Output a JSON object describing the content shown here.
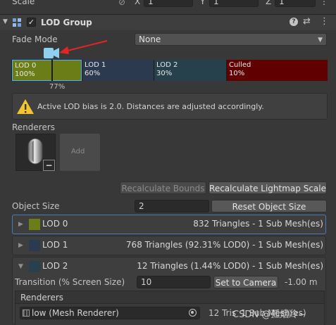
{
  "scale": {
    "label": "Scale",
    "x_label": "X",
    "x_value": "1",
    "y_label": "Y",
    "y_value": "1",
    "z_label": "Z",
    "z_value": "1"
  },
  "component": {
    "title": "LOD Group",
    "enabled": true
  },
  "fade_mode": {
    "label": "Fade Mode",
    "value": "None"
  },
  "lod_bar": {
    "marker_label": "77%",
    "segments": [
      {
        "name": "LOD 0",
        "percent": "100%",
        "color": "#6b7d17"
      },
      {
        "name": "LOD 1",
        "percent": "60%",
        "color": "#2c3a50"
      },
      {
        "name": "LOD 2",
        "percent": "30%",
        "color": "#27414c"
      },
      {
        "name": "Culled",
        "percent": "10%",
        "color": "#610000"
      }
    ]
  },
  "warning": {
    "text": "Active LOD bias is 2.0. Distances are adjusted accordingly."
  },
  "renderers_section": {
    "label": "Renderers",
    "add_label": "Add"
  },
  "buttons": {
    "recalc_bounds": "Recalculate Bounds",
    "recalc_lightmap": "Recalculate Lightmap Scale"
  },
  "object_size": {
    "label": "Object Size",
    "value": "2",
    "reset_label": "Reset Object Size"
  },
  "lod_rows": [
    {
      "name": "LOD 0",
      "info": "832 Triangles  - 1 Sub Mesh(es)",
      "color": "#6b7d17",
      "expanded": false
    },
    {
      "name": "LOD 1",
      "info": "768 Triangles (92.31% LOD0) - 1 Sub Mesh(es)",
      "color": "#2c3a50",
      "expanded": false
    },
    {
      "name": "LOD 2",
      "info": "12 Triangles (1.44% LOD0) - 1 Sub Mesh(es)",
      "color": "#27414c",
      "expanded": true
    }
  ],
  "transition": {
    "label": "Transition (% Screen Size)",
    "value": "10",
    "button": "Set to Camera",
    "distance": "-1.00 m"
  },
  "lod2_renderers": {
    "label": "Renderers",
    "item": "low (Mesh Renderer)",
    "tris": "12 Tris",
    "sub": "1 Sub Mesh(es)"
  },
  "watermark": "CSDN @孤烟冷~"
}
